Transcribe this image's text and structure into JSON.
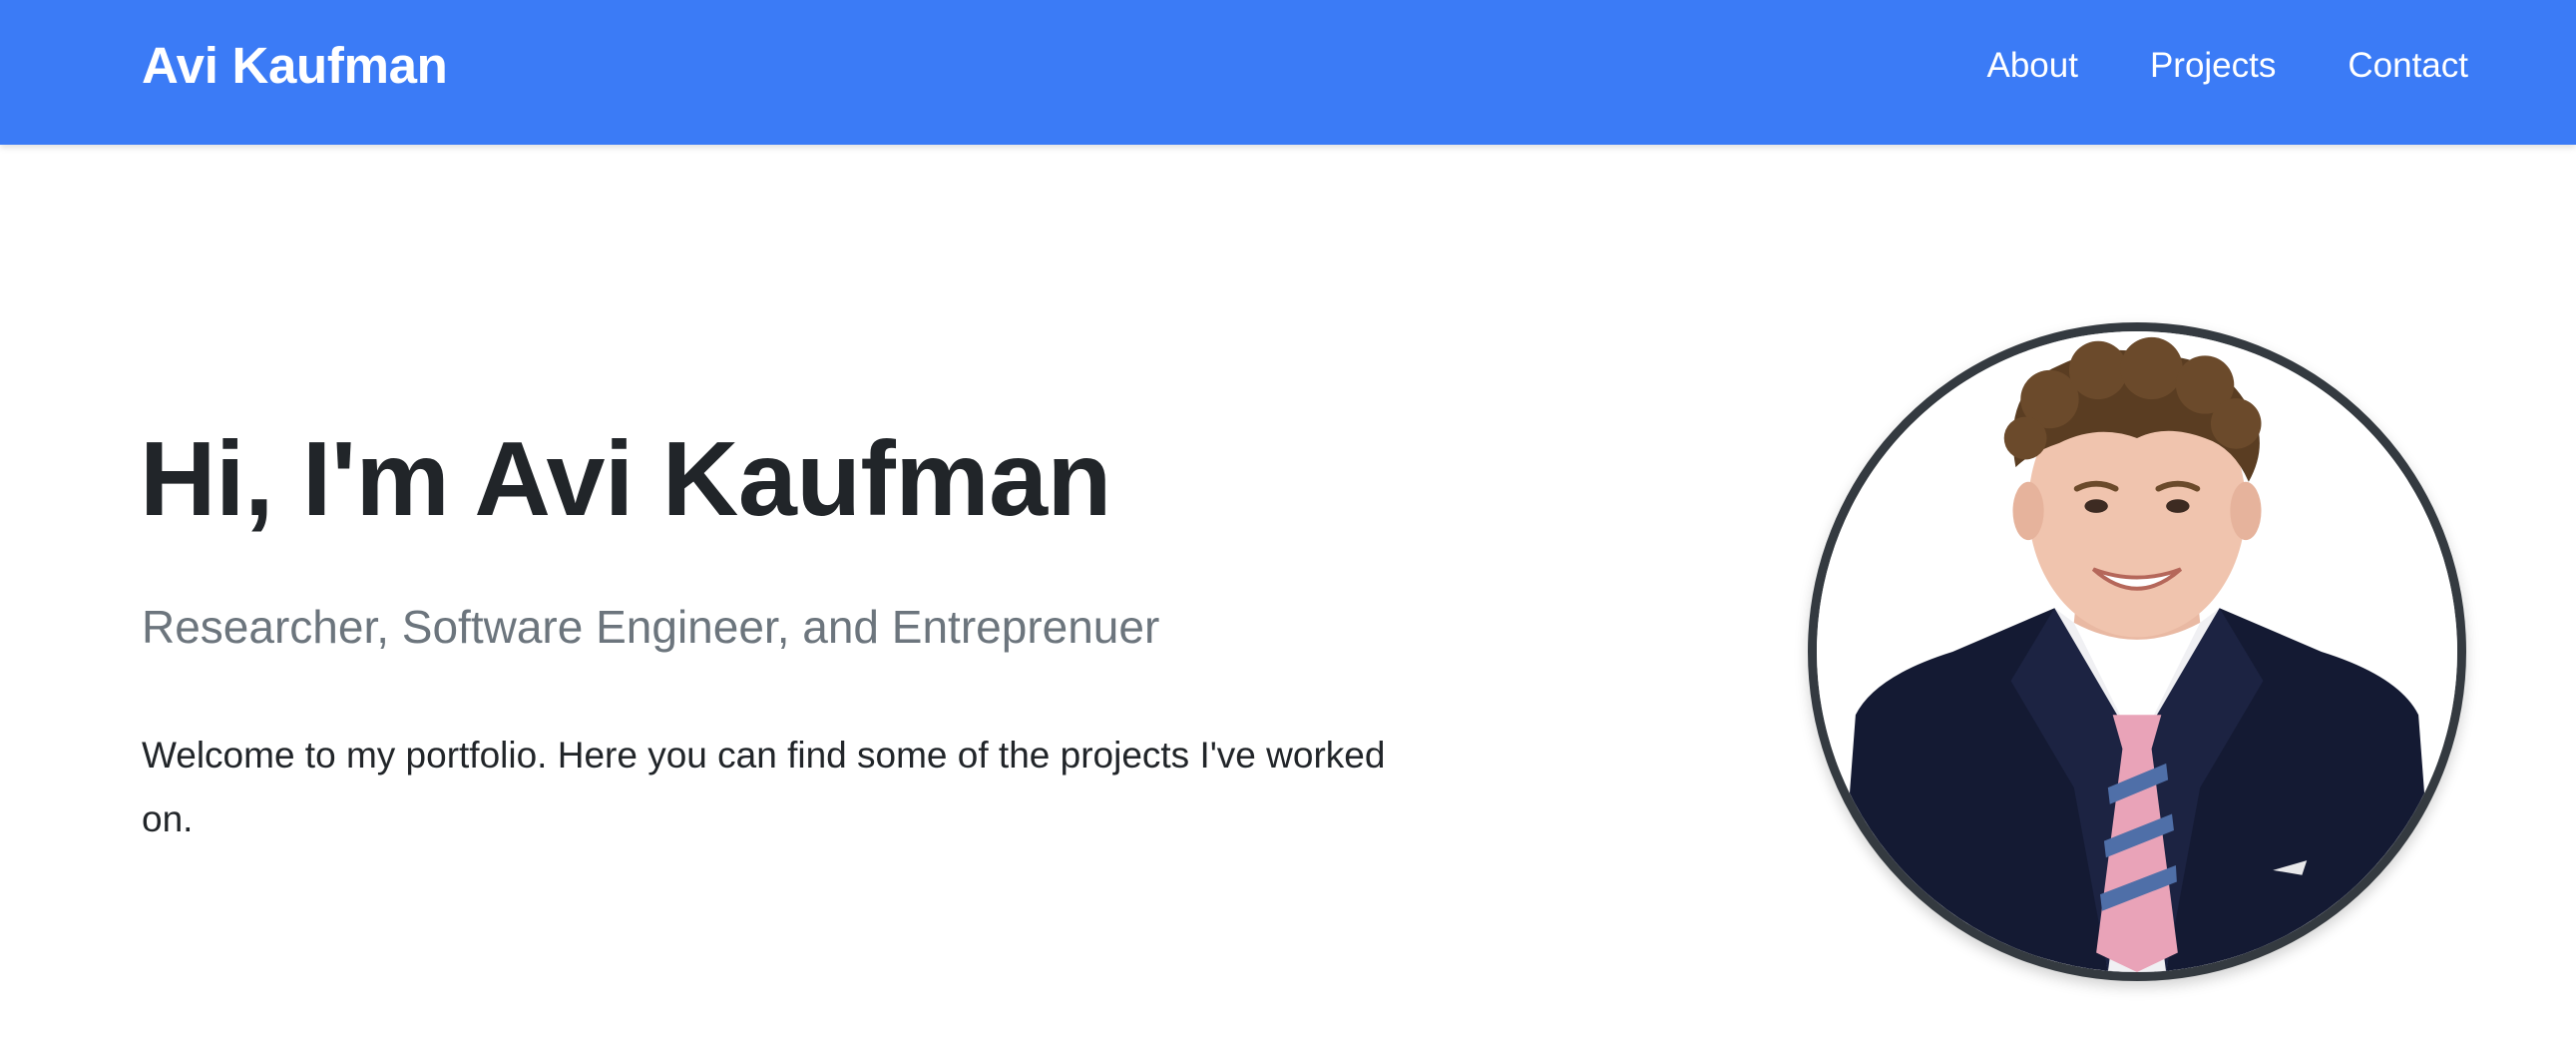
{
  "navbar": {
    "brand": "Avi Kaufman",
    "links": [
      {
        "label": "About"
      },
      {
        "label": "Projects"
      },
      {
        "label": "Contact"
      }
    ],
    "color": "#3b7bf6"
  },
  "hero": {
    "title": "Hi, I'm Avi Kaufman",
    "subtitle": "Researcher, Software Engineer, and Entreprenuer",
    "text": "Welcome to my portfolio. Here you can find some of the projects I've worked on."
  },
  "colors": {
    "heading": "#212529",
    "muted": "#6c757d",
    "avatar_border": "#343a40"
  }
}
